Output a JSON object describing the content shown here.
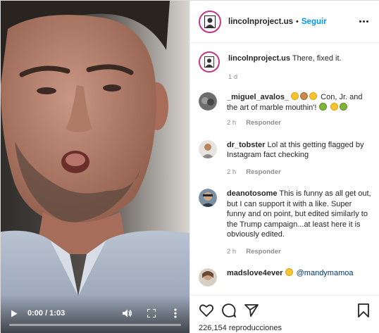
{
  "video": {
    "time": "0:00 / 1:03",
    "progress": 0.0
  },
  "post": {
    "username": "lincolnproject.us",
    "separator": "•",
    "follow_label": "Seguir"
  },
  "caption": {
    "username": "lincolnproject.us",
    "text": "There, fixed it.",
    "age": "1 d"
  },
  "comments": [
    {
      "username": "_miguel_avalos_",
      "text_after_emojis": " Con, Jr. and the art of marble mouthin'! ",
      "time": "2 h",
      "reply": "Responder"
    },
    {
      "username": "dr_tobster",
      "text": "Lol at this getting flagged by Instagram fact checking",
      "time": "2 h",
      "reply": "Responder"
    },
    {
      "username": "deanotosome",
      "text": "This is funny as all get out, but I can support it with a like. Super funny and on point, but edited similarly to the Trump campaign...at least here it is obviously edited.",
      "time": "2 h",
      "reply": "Responder"
    },
    {
      "username": "madslove4ever",
      "mention": "@mandymamoa"
    }
  ],
  "stats": {
    "views": "226,154 reproducciones"
  },
  "icons": {
    "like": "heart-icon",
    "comment": "comment-icon",
    "share": "share-icon",
    "save": "bookmark-icon",
    "more": "more-icon",
    "play": "play-icon",
    "volume": "volume-icon",
    "fullscreen": "fullscreen-icon",
    "video_menu": "kebab-icon"
  },
  "colors": {
    "follow": "#0095f6",
    "avatar_ring": "#c13584",
    "meta": "#8e8e8e",
    "mention": "#00376b"
  }
}
